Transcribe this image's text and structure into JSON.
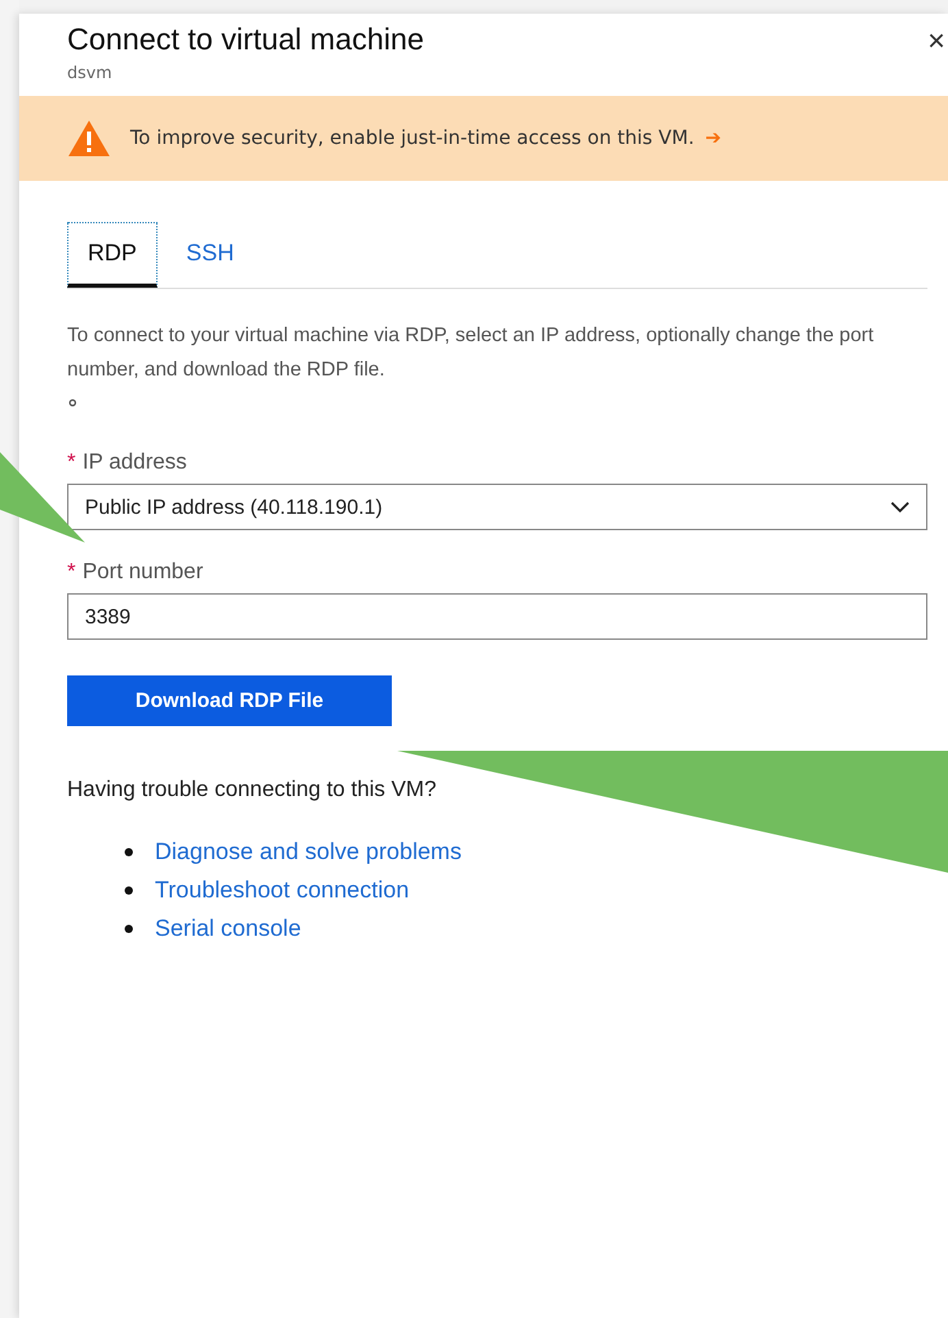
{
  "blade": {
    "title": "Connect to virtual machine",
    "subtitle": "dsvm",
    "close": "×"
  },
  "banner": {
    "message": "To improve security, enable just-in-time access on this VM.",
    "arrow": "➔"
  },
  "tabs": [
    {
      "label": "RDP",
      "selected": true
    },
    {
      "label": "SSH",
      "selected": false
    }
  ],
  "description": "To connect to your virtual machine via RDP, select an IP address, optionally change the port number, and download the RDP file.",
  "fields": [
    {
      "kind": "dropdown",
      "label": "IP address",
      "required_mark": "*",
      "value": "Public IP address (40.118.190.1)"
    },
    {
      "kind": "text",
      "label": "Port number",
      "required_mark": "*",
      "value": "3389"
    }
  ],
  "download_button": "Download RDP File",
  "trouble": {
    "heading": "Having trouble connecting to this VM?",
    "links": [
      "Diagnose and solve problems",
      "Troubleshoot connection",
      "Serial console"
    ]
  }
}
